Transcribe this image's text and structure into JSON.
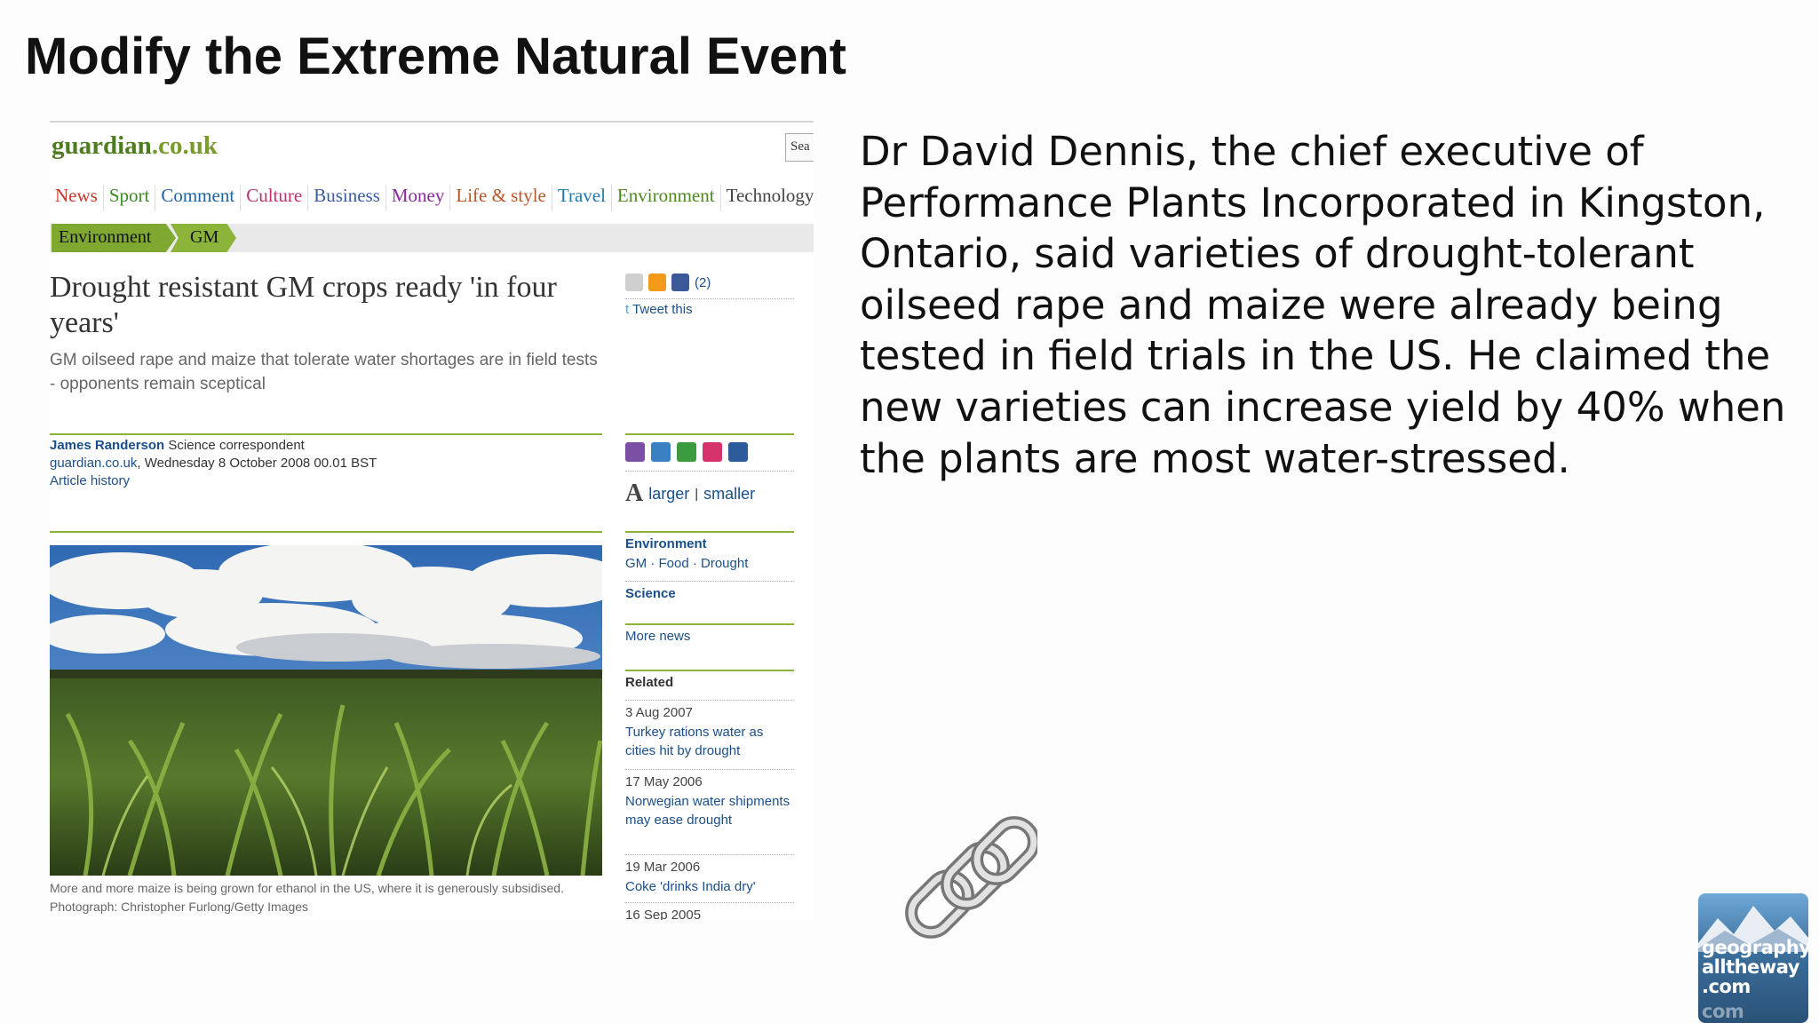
{
  "slide": {
    "title": "Modify the Extreme Natural Event",
    "quote": "Dr David Dennis, the chief executive of Performance Plants Incorporated in Kingston, Ontario, said varieties of drought-tolerant oilseed rape and maize were already being tested in field trials in the US. He claimed the new varieties can increase yield by 40% when the plants are most water-stressed."
  },
  "site": {
    "logo_main": "guardian",
    "logo_tld": ".co.uk",
    "search_value": "Sea"
  },
  "nav": [
    {
      "label": "News",
      "color": "#c8362a"
    },
    {
      "label": "Sport",
      "color": "#3a8a24"
    },
    {
      "label": "Comment",
      "color": "#1f63a0"
    },
    {
      "label": "Culture",
      "color": "#c0306f"
    },
    {
      "label": "Business",
      "color": "#3a5aa8"
    },
    {
      "label": "Money",
      "color": "#8a2b9b"
    },
    {
      "label": "Life & style",
      "color": "#b7562a"
    },
    {
      "label": "Travel",
      "color": "#1e79b3"
    },
    {
      "label": "Environment",
      "color": "#4f8a21"
    },
    {
      "label": "Technology",
      "color": "#444444"
    }
  ],
  "breadcrumb": [
    "Environment",
    "GM"
  ],
  "article": {
    "headline": "Drought resistant GM crops ready 'in four years'",
    "standfirst": "GM oilseed rape and maize that tolerate water shortages are in field tests - opponents remain sceptical",
    "author": "James Randerson",
    "author_role": "Science correspondent",
    "source": "guardian.co.uk",
    "date": ", Wednesday 8 October 2008 00.01 BST",
    "history_link": "Article history",
    "caption": "More and more maize is being grown for ethanol in the US, where it is generously subsidised. Photograph: Christopher Furlong/Getty Images"
  },
  "sidebar": {
    "share_count": "(2)",
    "tweet": "Tweet this",
    "size_letter": "A",
    "larger": "larger",
    "separator": "|",
    "smaller": "smaller",
    "environment_head": "Environment",
    "environment_tags": "GM · Food · Drought",
    "science_head": "Science",
    "more_news": "More news",
    "related_head": "Related",
    "related": [
      {
        "date": "3 Aug 2007",
        "title": "Turkey rations water as cities hit by drought"
      },
      {
        "date": "17 May 2006",
        "title": "Norwegian water shipments may ease drought"
      },
      {
        "date": "19 Mar 2006",
        "title": "Coke 'drinks India dry'"
      },
      {
        "date": "16 Sep 2005",
        "title": ""
      }
    ]
  },
  "logo": {
    "line1": "geography",
    "line2": "alltheway",
    "line3": ".com",
    "line4": "com"
  },
  "icons": {
    "link": "chain-link-icon",
    "share": [
      "share-icon",
      "bebo-icon",
      "facebook-icon"
    ],
    "tools": [
      "print-icon",
      "email-icon",
      "share-this-icon",
      "clip-icon",
      "contact-icon"
    ]
  }
}
